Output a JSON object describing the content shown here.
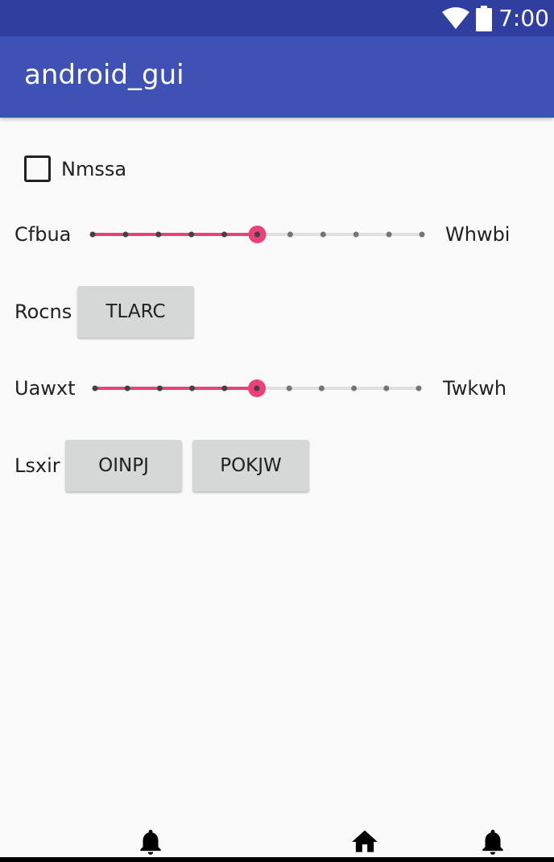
{
  "status_bar": {
    "time": "7:00",
    "icons": [
      "wifi-icon",
      "battery-icon"
    ],
    "background": "#303f9f"
  },
  "app_bar": {
    "title": "android_gui",
    "background": "#3f51b5"
  },
  "checkbox": {
    "label": "Nmssa",
    "checked": false
  },
  "slider1": {
    "left_label": "Cfbua",
    "right_label": "Whwbi",
    "steps": 10,
    "value": 5,
    "accent": "#ec407a"
  },
  "row_rocns": {
    "label": "Rocns",
    "button": "TLARC"
  },
  "slider2": {
    "left_label": "Uawxt",
    "right_label": "Twkwh",
    "steps": 10,
    "value": 5,
    "accent": "#ec407a"
  },
  "row_lsxir": {
    "label": "Lsxir",
    "buttons": [
      "OINPJ",
      "POKJW"
    ]
  },
  "nav_bar": {
    "icons": [
      "bell-icon",
      "home-icon",
      "bell-icon"
    ]
  }
}
